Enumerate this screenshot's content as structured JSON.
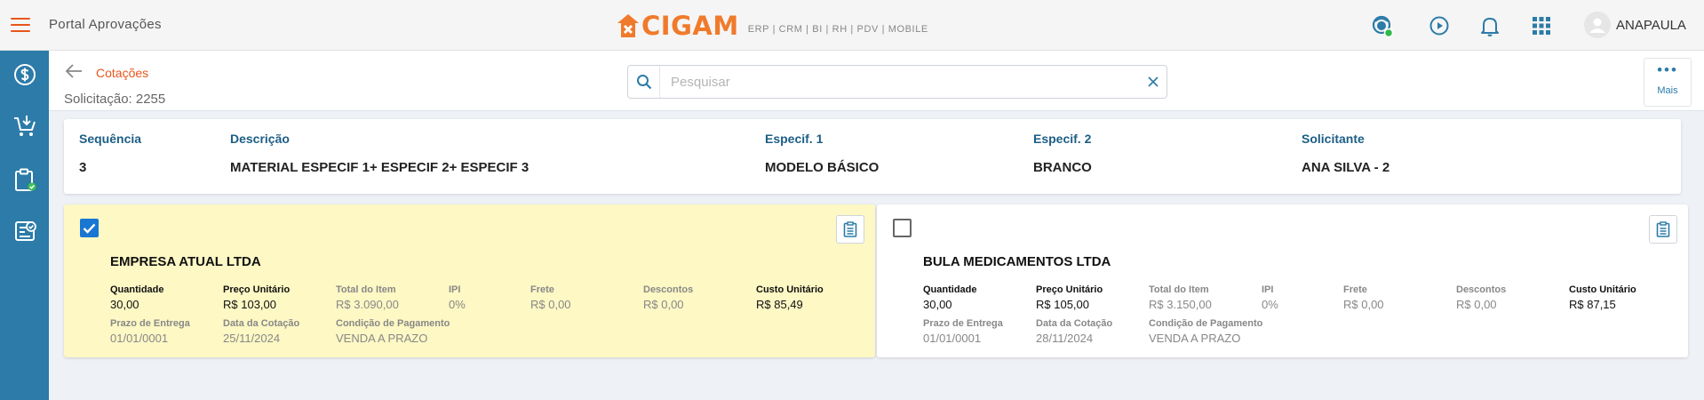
{
  "topbar": {
    "app_title": "Portal Aprovações",
    "brand_name": "CIGAM",
    "brand_tagline": "ERP | CRM | BI | RH | PDV | MOBILE",
    "user_name": "ANAPAULA",
    "accent_color": "#e8561b"
  },
  "sidebar": {
    "items": [
      "dollar-circle-icon",
      "cart-download-icon",
      "clipboard-check-icon",
      "approval-badge-icon"
    ],
    "color": "#2c7ba8"
  },
  "header": {
    "breadcrumb": "Cotações",
    "request": "Solicitação: 2255",
    "search_placeholder": "Pesquisar",
    "more_label": "Mais"
  },
  "item": {
    "sequence_label": "Sequência",
    "sequence_value": "3",
    "description_label": "Descrição",
    "description_value": "MATERIAL ESPECIF 1+ ESPECIF 2+ ESPECIF 3",
    "spec1_label": "Especif. 1",
    "spec1_value": "MODELO BÁSICO",
    "spec2_label": "Especif. 2",
    "spec2_value": "BRANCO",
    "requester_label": "Solicitante",
    "requester_value": "ANA SILVA - 2"
  },
  "labels": {
    "quantity": "Quantidade",
    "unit_price": "Preço Unitário",
    "item_total": "Total do Item",
    "ipi": "IPI",
    "freight": "Frete",
    "discounts": "Descontos",
    "unit_cost": "Custo Unitário",
    "delivery": "Prazo de Entrega",
    "quote_date": "Data da Cotação",
    "payment": "Condição de Pagamento"
  },
  "quotes": [
    {
      "selected": true,
      "supplier": "EMPRESA ATUAL LTDA",
      "quantity": "30,00",
      "unit_price": "R$ 103,00",
      "item_total": "R$ 3.090,00",
      "ipi": "0%",
      "freight": "R$ 0,00",
      "discounts": "R$ 0,00",
      "unit_cost": "R$ 85,49",
      "delivery": "01/01/0001",
      "quote_date": "25/11/2024",
      "payment": "VENDA A PRAZO",
      "background": "#fdf8c4"
    },
    {
      "selected": false,
      "supplier": "BULA MEDICAMENTOS LTDA",
      "quantity": "30,00",
      "unit_price": "R$ 105,00",
      "item_total": "R$ 3.150,00",
      "ipi": "0%",
      "freight": "R$ 0,00",
      "discounts": "R$ 0,00",
      "unit_cost": "R$ 87,15",
      "delivery": "01/01/0001",
      "quote_date": "28/11/2024",
      "payment": "VENDA A PRAZO",
      "background": "#ffffff"
    }
  ]
}
